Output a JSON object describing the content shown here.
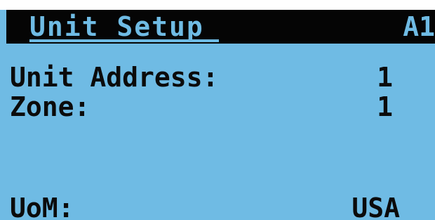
{
  "header": {
    "title": "Unit Setup",
    "screen_id": "A1"
  },
  "rows": [
    {
      "label": "Unit Address:",
      "value": "1"
    },
    {
      "label": "Zone:",
      "value": "1"
    }
  ],
  "footer": {
    "label": "UoM:",
    "value": "USA"
  },
  "colors": {
    "screen_background": "#6fbbe4",
    "title_bar": "#050505",
    "text": "#0b0b0b"
  }
}
